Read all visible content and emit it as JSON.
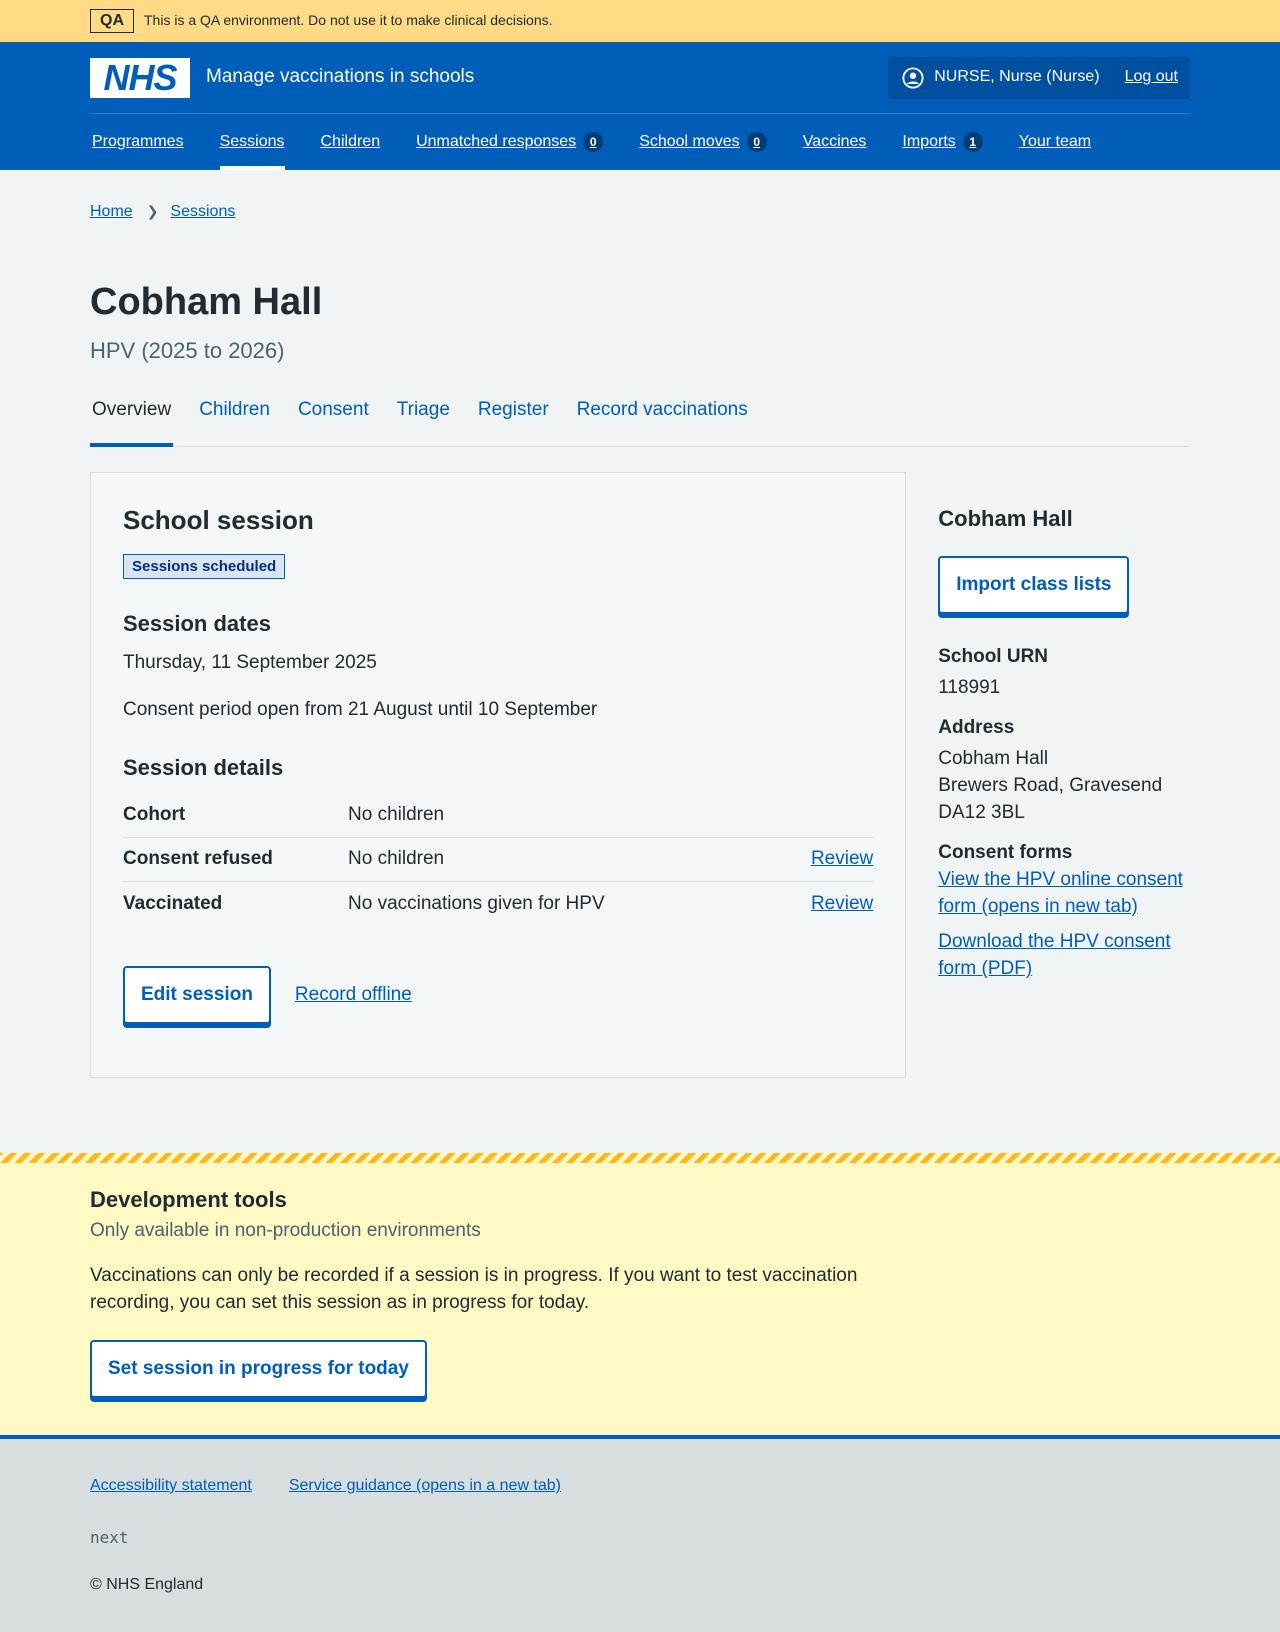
{
  "qa_banner": {
    "tag": "QA",
    "text": "This is a QA environment. Do not use it to make clinical decisions."
  },
  "header": {
    "logo": "NHS",
    "service_name": "Manage vaccinations in schools",
    "user": "NURSE, Nurse (Nurse)",
    "logout": "Log out"
  },
  "nav": {
    "programmes": "Programmes",
    "sessions": "Sessions",
    "children": "Children",
    "unmatched": "Unmatched responses",
    "unmatched_count": "0",
    "school_moves": "School moves",
    "school_moves_count": "0",
    "vaccines": "Vaccines",
    "imports": "Imports",
    "imports_count": "1",
    "your_team": "Your team",
    "active": "Sessions"
  },
  "breadcrumb": {
    "home": "Home",
    "sessions": "Sessions"
  },
  "page": {
    "title": "Cobham Hall",
    "caption": "HPV (2025 to 2026)"
  },
  "tabs": {
    "overview": "Overview",
    "children": "Children",
    "consent": "Consent",
    "triage": "Triage",
    "register": "Register",
    "record": "Record vaccinations",
    "active": "Overview"
  },
  "card": {
    "title": "School session",
    "status": "Sessions scheduled",
    "dates_heading": "Session dates",
    "date": "Thursday, 11 September 2025",
    "consent_period": "Consent period open from 21 August until 10 September",
    "details_heading": "Session details",
    "rows": [
      {
        "key": "Cohort",
        "value": "No children",
        "action": ""
      },
      {
        "key": "Consent refused",
        "value": "No children",
        "action": "Review"
      },
      {
        "key": "Vaccinated",
        "value": "No vaccinations given for HPV",
        "action": "Review"
      }
    ],
    "edit_button": "Edit session",
    "record_offline": "Record offline"
  },
  "sidebar": {
    "title": "Cobham Hall",
    "import_button": "Import class lists",
    "urn_label": "School URN",
    "urn": "118991",
    "address_label": "Address",
    "address_line1": "Cobham Hall",
    "address_line2": "Brewers Road, Gravesend",
    "address_line3": "DA12 3BL",
    "consent_forms_label": "Consent forms",
    "online_form_link": "View the HPV online consent form (opens in new tab)",
    "pdf_link": "Download the HPV consent form (PDF)"
  },
  "dev_tools": {
    "title": "Development tools",
    "caption": "Only available in non-production environments",
    "text": "Vaccinations can only be recorded if a session is in progress. If you want to test vaccination recording, you can set this session as in progress for today.",
    "button": "Set session in progress for today"
  },
  "footer": {
    "accessibility": "Accessibility statement",
    "guidance": "Service guidance (opens in a new tab)",
    "version": "next",
    "copyright": "© NHS England"
  },
  "colors": {
    "brand_blue": "#005eb8",
    "qa_yellow": "#ffdb85",
    "dev_yellow": "#fff9c4",
    "stripe": "#ffb81c"
  }
}
